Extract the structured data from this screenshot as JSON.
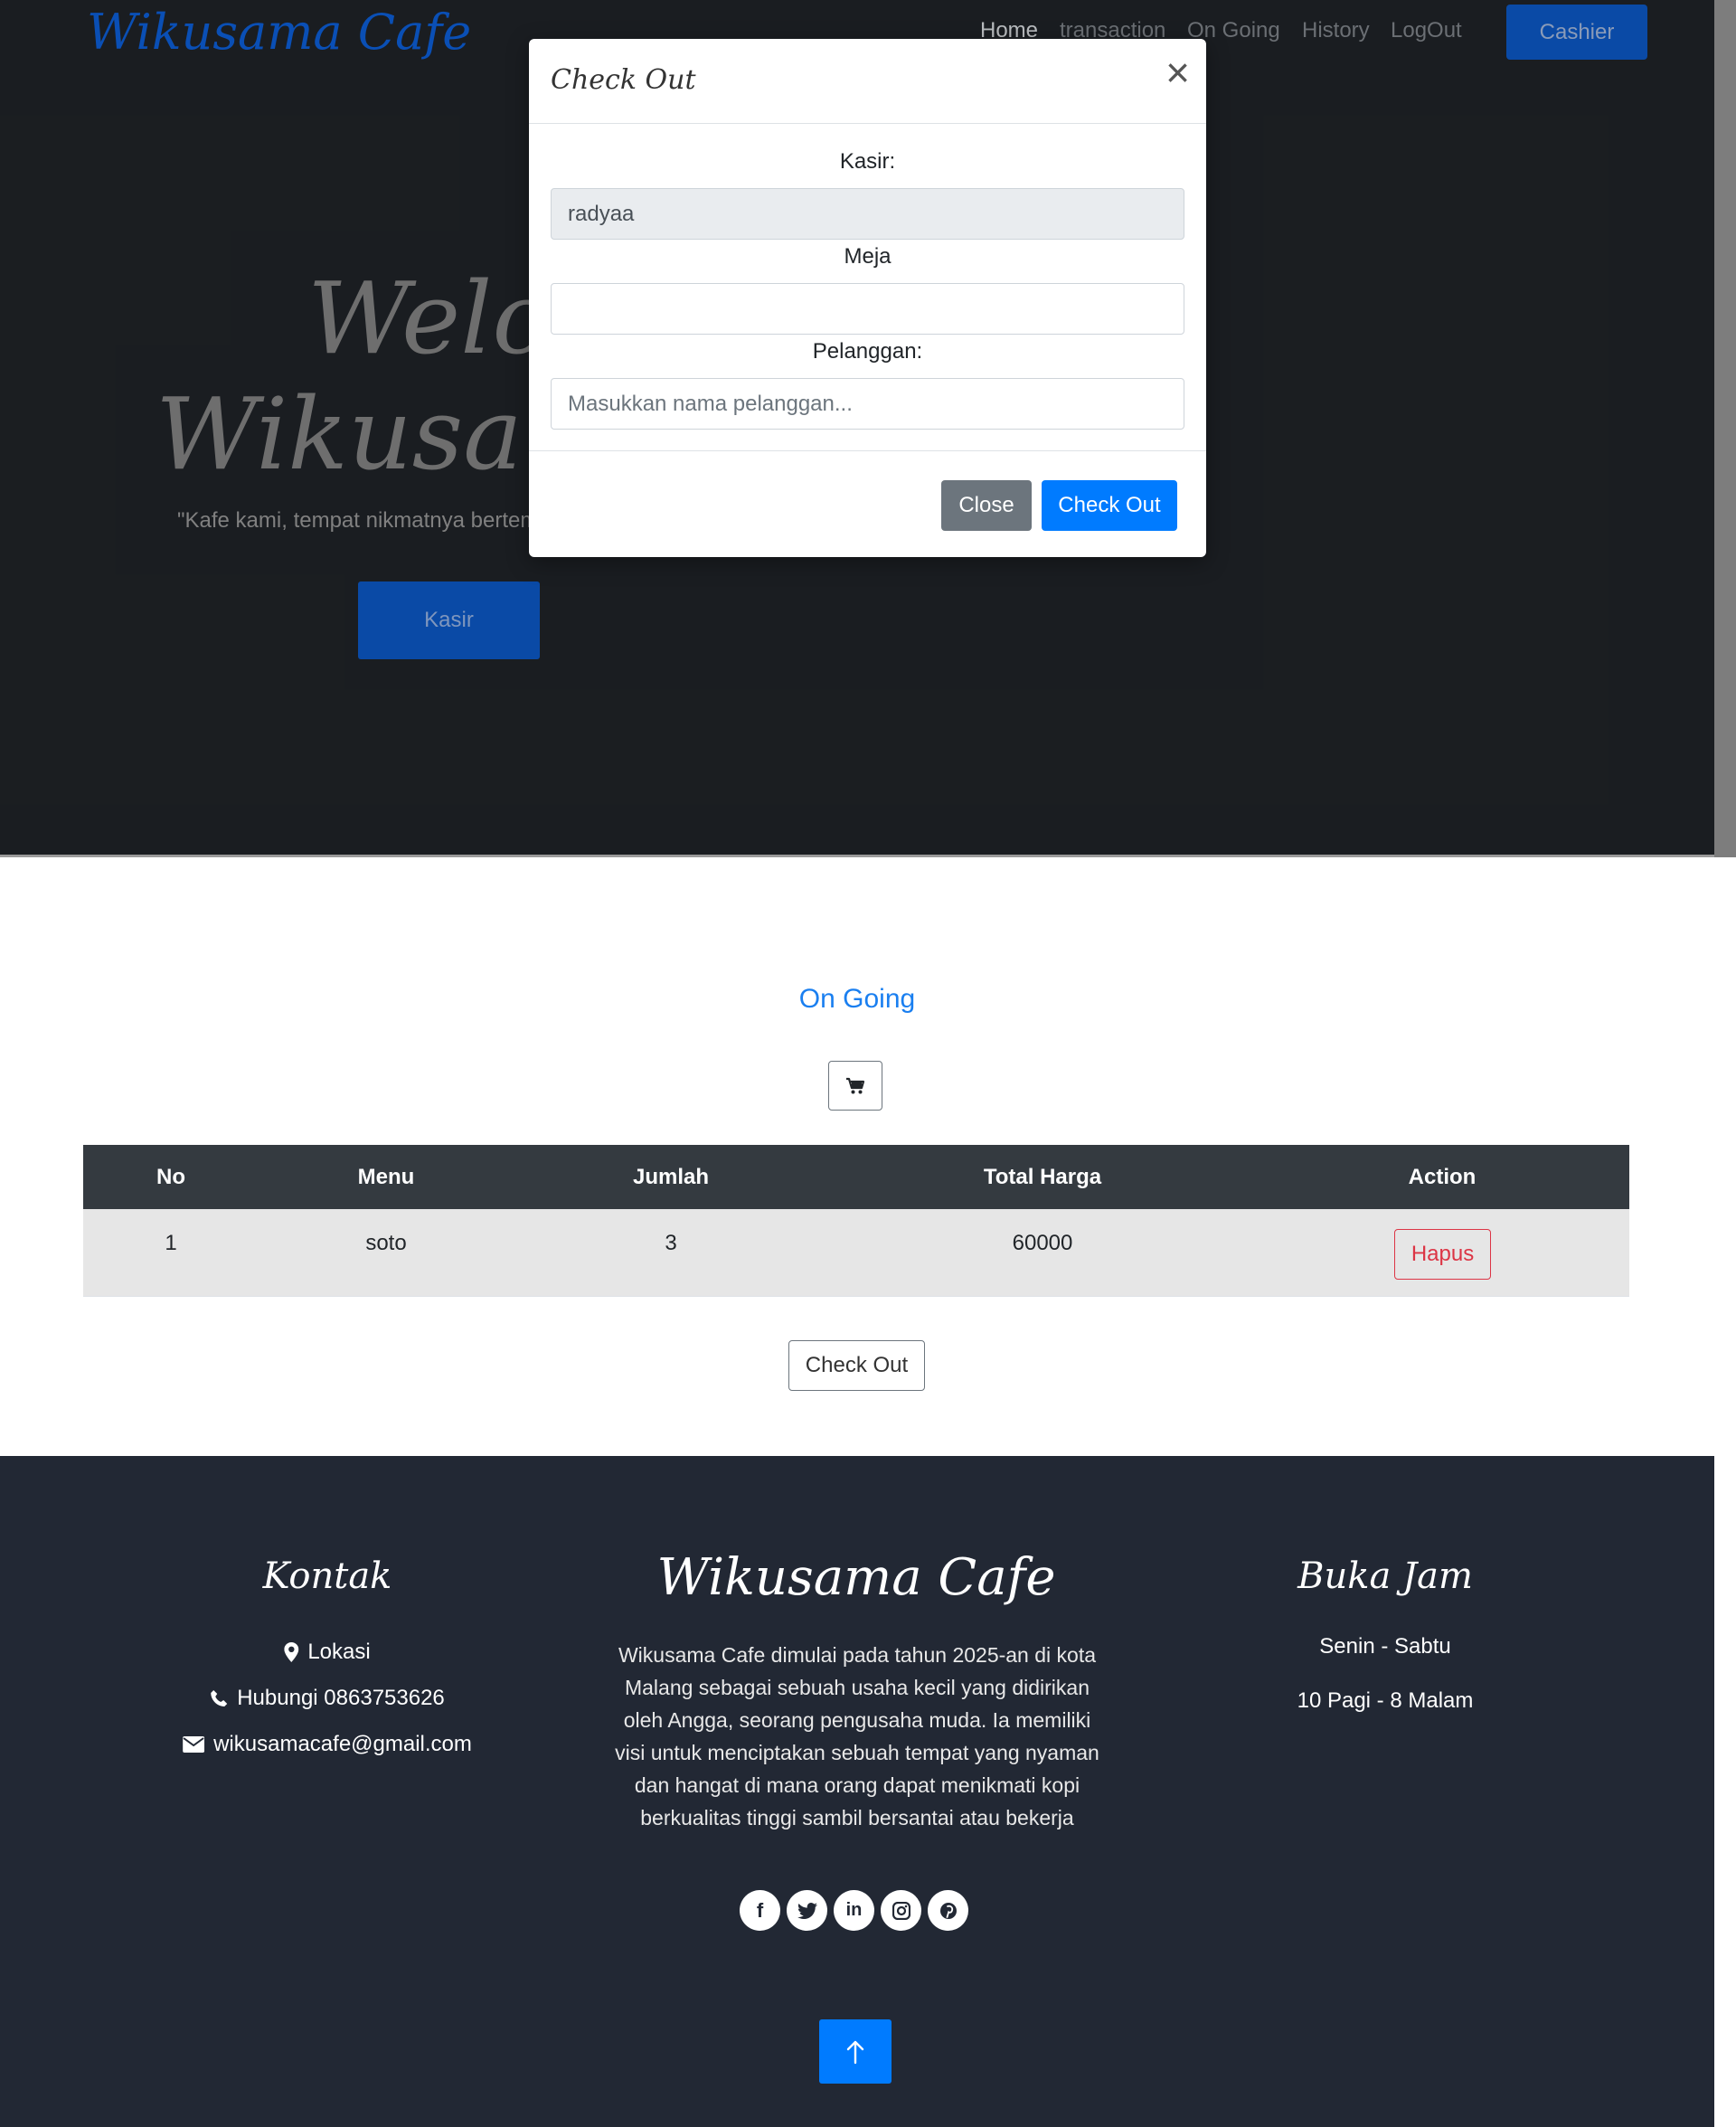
{
  "header": {
    "brand": "Wikusama Cafe",
    "nav": [
      "Home",
      "transaction",
      "On Going",
      "History",
      "LogOut"
    ],
    "cashier_button": "Cashier"
  },
  "hero": {
    "welcome_line1": "Welcome",
    "welcome_line2": "Wikusama Cafe",
    "tagline": "\"Kafe kami, tempat nikmatnya bertemu\"",
    "kasir_button": "Kasir"
  },
  "modal": {
    "title": "Check Out",
    "close_icon": "×",
    "kasir_label": "Kasir:",
    "kasir_value": "radyaa",
    "meja_label": "Meja",
    "meja_value": "",
    "pelanggan_label": "Pelanggan:",
    "pelanggan_placeholder": "Masukkan nama pelanggan...",
    "close_button": "Close",
    "checkout_button": "Check Out"
  },
  "ongoing": {
    "title": "On Going",
    "cart_icon": "cart-icon",
    "columns": [
      "No",
      "Menu",
      "Jumlah",
      "Total Harga",
      "Action"
    ],
    "rows": [
      {
        "no": "1",
        "menu": "soto",
        "jumlah": "3",
        "total": "60000",
        "action": "Hapus"
      }
    ],
    "checkout_button": "Check Out"
  },
  "footer": {
    "kontak_title": "Kontak",
    "lokasi": "Lokasi",
    "phone": "Hubungi 0863753626",
    "email": "wikusamacafe@gmail.com",
    "brand": "Wikusama Cafe",
    "description": "Wikusama Cafe dimulai pada tahun 2025-an di kota Malang sebagai sebuah usaha kecil yang didirikan oleh Angga, seorang pengusaha muda. Ia memiliki visi untuk menciptakan sebuah tempat yang nyaman dan hangat di mana orang dapat menikmati kopi berkualitas tinggi sambil bersantai atau bekerja",
    "hours_title": "Buka Jam",
    "days": "Senin - Sabtu",
    "hours": "10 Pagi - 8 Malam",
    "socials": [
      "facebook-icon",
      "twitter-icon",
      "linkedin-icon",
      "instagram-icon",
      "pinterest-icon"
    ]
  },
  "colors": {
    "primary": "#007bff",
    "brand_blue": "#0a4aa6",
    "danger": "#dc3545",
    "dark_header": "#343a40",
    "footer_bg": "#222834"
  }
}
